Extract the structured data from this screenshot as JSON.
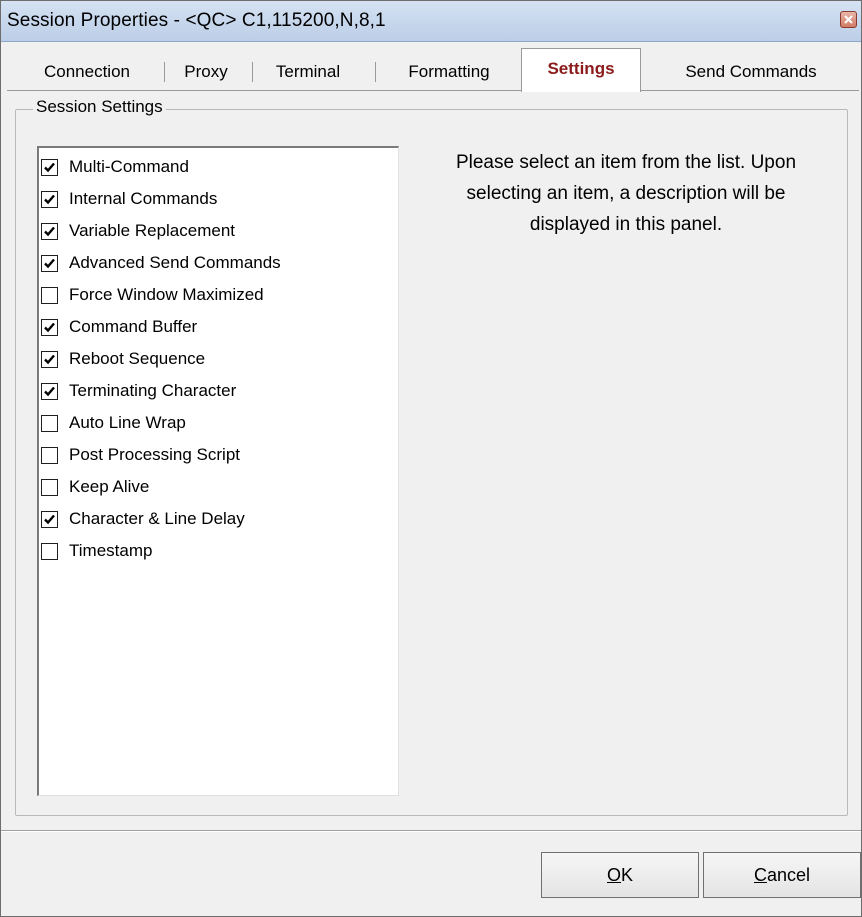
{
  "window": {
    "title": "Session Properties - <QC> C1,115200,N,8,1"
  },
  "tabs": [
    {
      "label": "Connection",
      "active": false
    },
    {
      "label": "Proxy",
      "active": false
    },
    {
      "label": "Terminal",
      "active": false
    },
    {
      "label": "Formatting",
      "active": false
    },
    {
      "label": "Settings",
      "active": true
    },
    {
      "label": "Send Commands",
      "active": false
    }
  ],
  "group": {
    "label": "Session Settings"
  },
  "settings_list": [
    {
      "label": "Multi-Command",
      "checked": true
    },
    {
      "label": "Internal Commands",
      "checked": true
    },
    {
      "label": "Variable Replacement",
      "checked": true
    },
    {
      "label": "Advanced Send Commands",
      "checked": true
    },
    {
      "label": "Force Window Maximized",
      "checked": false
    },
    {
      "label": "Command Buffer",
      "checked": true
    },
    {
      "label": "Reboot Sequence",
      "checked": true
    },
    {
      "label": "Terminating Character",
      "checked": true
    },
    {
      "label": "Auto Line Wrap",
      "checked": false
    },
    {
      "label": "Post Processing Script",
      "checked": false
    },
    {
      "label": "Keep Alive",
      "checked": false
    },
    {
      "label": "Character & Line Delay",
      "checked": true
    },
    {
      "label": "Timestamp",
      "checked": false
    }
  ],
  "description": {
    "text": "Please select an item from the list. Upon selecting an item, a description will be displayed in this panel."
  },
  "buttons": {
    "ok": {
      "mnemonic": "O",
      "rest": "K"
    },
    "cancel": {
      "mnemonic": "C",
      "rest": "ancel"
    }
  },
  "colors": {
    "active_tab_text": "#8b1a1a",
    "titlebar": "#c6d6ec",
    "dialog_bg": "#f0f0f0"
  },
  "icons": {
    "close": "close-icon",
    "check": "checkmark-icon"
  }
}
